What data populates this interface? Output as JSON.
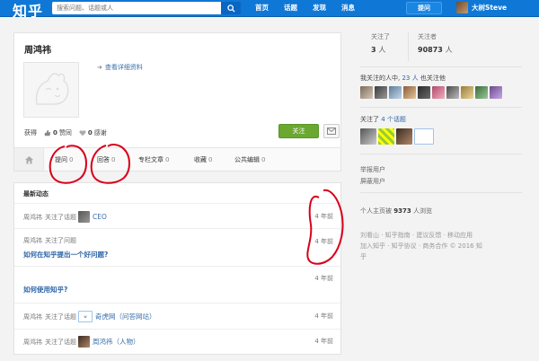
{
  "topbar": {
    "logo": "知乎",
    "search_placeholder": "搜索问题、话题或人",
    "nav": [
      "首页",
      "话题",
      "发现",
      "消息"
    ],
    "ask_label": "提问",
    "username": "大树Steve"
  },
  "profile": {
    "name": "周鸿祎",
    "detail_link": "查看详细资料",
    "obtained_label": "获得",
    "likes": "0",
    "likes_label": "赞同",
    "thanks": "0",
    "thanks_label": "感谢",
    "follow_label": "关注",
    "tabs": [
      {
        "label": "提问",
        "count": "0"
      },
      {
        "label": "回答",
        "count": "0"
      },
      {
        "label": "专栏文章",
        "count": "0"
      },
      {
        "label": "收藏",
        "count": "0"
      },
      {
        "label": "公共编辑",
        "count": "0"
      }
    ]
  },
  "activity": {
    "title": "最新动态",
    "items": [
      {
        "actor": "周鸿祎",
        "action": "关注了话题",
        "target": "CEO",
        "question": "",
        "when": "4 年前"
      },
      {
        "actor": "周鸿祎",
        "action": "关注了问题",
        "target": "",
        "question": "如何在知乎提出一个好问题?",
        "when": "4 年前"
      },
      {
        "actor": "",
        "action": "",
        "target": "",
        "question": "如何使用知乎?",
        "when": "4 年前"
      },
      {
        "actor": "周鸿祎",
        "action": "关注了话题",
        "target": "奇虎网（问答网站）",
        "question": "",
        "when": "4 年前"
      },
      {
        "actor": "周鸿祎",
        "action": "关注了话题",
        "target": "周鸿祎（人物）",
        "question": "",
        "when": "4 年前"
      }
    ]
  },
  "sidebar": {
    "following_label": "关注了",
    "following_count": "3",
    "followers_label": "关注者",
    "followers_count": "90873",
    "unit": "人",
    "mutual_prefix": "我关注的人中,",
    "mutual_count": "23 人",
    "mutual_suffix": "也关注他",
    "topics_prefix": "关注了",
    "topics_count": "4 个话题",
    "report": "举报用户",
    "block": "屏蔽用户",
    "views_prefix": "个人主页被",
    "views_count": "9373",
    "views_suffix": "人浏览",
    "footer_line1": "刘看山 · 知乎指南 · 建议反馈 · 移动应用",
    "footer_line2": "加入知乎 · 知乎协议 · 商务合作 © 2016 知",
    "footer_line3": "乎"
  },
  "colors": {
    "brand": "#0f77d6",
    "link": "#2f65a8",
    "follow_green": "#6aa830",
    "annotation_red": "#d9001b"
  }
}
